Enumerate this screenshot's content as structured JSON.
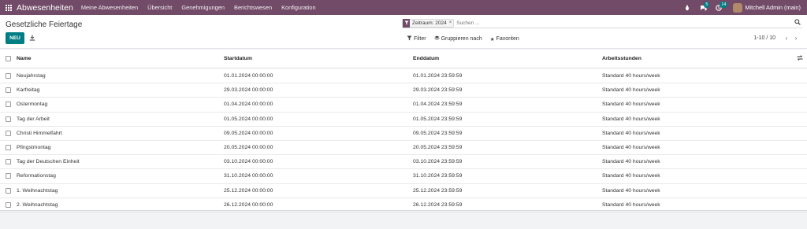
{
  "navbar": {
    "brand": "Abwesenheiten",
    "menu": [
      "Meine Abwesenheiten",
      "Übersicht",
      "Genehmigungen",
      "Berichtswesen",
      "Konfiguration"
    ],
    "messages_count": "5",
    "activities_count": "14",
    "user": "Mitchell Admin (main)"
  },
  "control": {
    "title": "Gesetzliche Feiertage",
    "new_label": "NEU",
    "facet_label": "Zeitraum: 2024",
    "facet_close": "×",
    "search_placeholder": "Suchen ...",
    "filter_label": "Filter",
    "group_label": "Gruppieren nach",
    "favorites_label": "Favoriten",
    "pager": "1-10 / 10"
  },
  "table": {
    "headers": {
      "name": "Name",
      "start": "Startdatum",
      "end": "Enddatum",
      "hours": "Arbeitsstunden"
    },
    "rows": [
      {
        "name": "Neujahrstag",
        "start": "01.01.2024 00:00:00",
        "end": "01.01.2024 23:59:59",
        "hours": "Standard 40 hours/week"
      },
      {
        "name": "Karfreitag",
        "start": "29.03.2024 00:00:00",
        "end": "29.03.2024 23:59:59",
        "hours": "Standard 40 hours/week"
      },
      {
        "name": "Ostermontag",
        "start": "01.04.2024 00:00:00",
        "end": "01.04.2024 23:59:59",
        "hours": "Standard 40 hours/week"
      },
      {
        "name": "Tag der Arbeit",
        "start": "01.05.2024 00:00:00",
        "end": "01.05.2024 23:59:59",
        "hours": "Standard 40 hours/week"
      },
      {
        "name": "Christi Himmelfahrt",
        "start": "09.05.2024 00:00:00",
        "end": "09.05.2024 23:59:59",
        "hours": "Standard 40 hours/week"
      },
      {
        "name": "Pfingstmontag",
        "start": "20.05.2024 00:00:00",
        "end": "20.05.2024 23:59:59",
        "hours": "Standard 40 hours/week"
      },
      {
        "name": "Tag der Deutschen Einheit",
        "start": "03.10.2024 00:00:00",
        "end": "03.10.2024 23:59:59",
        "hours": "Standard 40 hours/week"
      },
      {
        "name": "Reformationstag",
        "start": "31.10.2024 00:00:00",
        "end": "31.10.2024 23:59:59",
        "hours": "Standard 40 hours/week"
      },
      {
        "name": "1. Weihnachtstag",
        "start": "25.12.2024 00:00:00",
        "end": "25.12.2024 23:59:59",
        "hours": "Standard 40 hours/week"
      },
      {
        "name": "2. Weihnachtstag",
        "start": "26.12.2024 00:00:00",
        "end": "26.12.2024 23:59:59",
        "hours": "Standard 40 hours/week"
      }
    ]
  },
  "colors": {
    "navbar": "#714b67",
    "primary_button": "#017e84",
    "badge": "#017e84"
  }
}
